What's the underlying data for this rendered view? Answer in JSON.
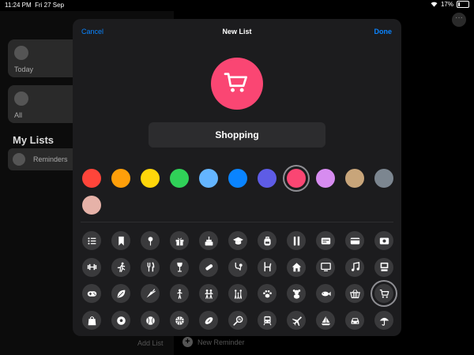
{
  "status_bar": {
    "time": "11:24 PM",
    "date": "Fri 27 Sep",
    "battery": "17%",
    "wifi_icon": "wifi-icon"
  },
  "background": {
    "today_label": "Today",
    "all_label": "All",
    "my_lists_heading": "My Lists",
    "reminders_label": "Reminders",
    "add_list_label": "Add List",
    "new_reminder_label": "New Reminder"
  },
  "dialog": {
    "cancel_label": "Cancel",
    "title": "New List",
    "done_label": "Done",
    "list_name": "Shopping",
    "icon": "cart-icon",
    "accent_color": "#fa4673"
  },
  "colors": [
    {
      "name": "red",
      "hex": "#ff453a",
      "selected": false
    },
    {
      "name": "orange",
      "hex": "#ff9f0a",
      "selected": false
    },
    {
      "name": "yellow",
      "hex": "#ffd60a",
      "selected": false
    },
    {
      "name": "green",
      "hex": "#30d158",
      "selected": false
    },
    {
      "name": "light-blue",
      "hex": "#64b5ff",
      "selected": false
    },
    {
      "name": "blue",
      "hex": "#0a84ff",
      "selected": false
    },
    {
      "name": "indigo",
      "hex": "#5e5ce6",
      "selected": false
    },
    {
      "name": "pink",
      "hex": "#fa4673",
      "selected": true
    },
    {
      "name": "purple",
      "hex": "#d78cf0",
      "selected": false
    },
    {
      "name": "brown",
      "hex": "#c8a57a",
      "selected": false
    },
    {
      "name": "gray",
      "hex": "#7c8690",
      "selected": false
    },
    {
      "name": "rose-gold",
      "hex": "#e6b2a8",
      "selected": false
    }
  ],
  "icons": [
    "list-icon",
    "bookmark-icon",
    "pin-icon",
    "gift-icon",
    "birthday-cake-icon",
    "graduation-cap-icon",
    "backpack-icon",
    "pencil-ruler-icon",
    "document-icon",
    "credit-card-icon",
    "money-icon",
    "dumbbell-icon",
    "running-icon",
    "fork-knife-icon",
    "wine-glass-icon",
    "pills-icon",
    "stethoscope-icon",
    "chair-icon",
    "house-icon",
    "tv-icon",
    "music-note-icon",
    "computer-icon",
    "gamepad-icon",
    "leaf-icon",
    "carrot-icon",
    "person-icon",
    "two-people-icon",
    "family-icon",
    "paw-icon",
    "teddy-bear-icon",
    "fish-icon",
    "basket-icon",
    "cart-icon",
    "shopping-bag-icon",
    "soccer-ball-icon",
    "baseball-icon",
    "basketball-icon",
    "football-icon",
    "tennis-racket-icon",
    "train-icon",
    "airplane-icon",
    "sailboat-icon",
    "car-icon",
    "umbrella-icon"
  ],
  "selected_icon": "cart-icon"
}
